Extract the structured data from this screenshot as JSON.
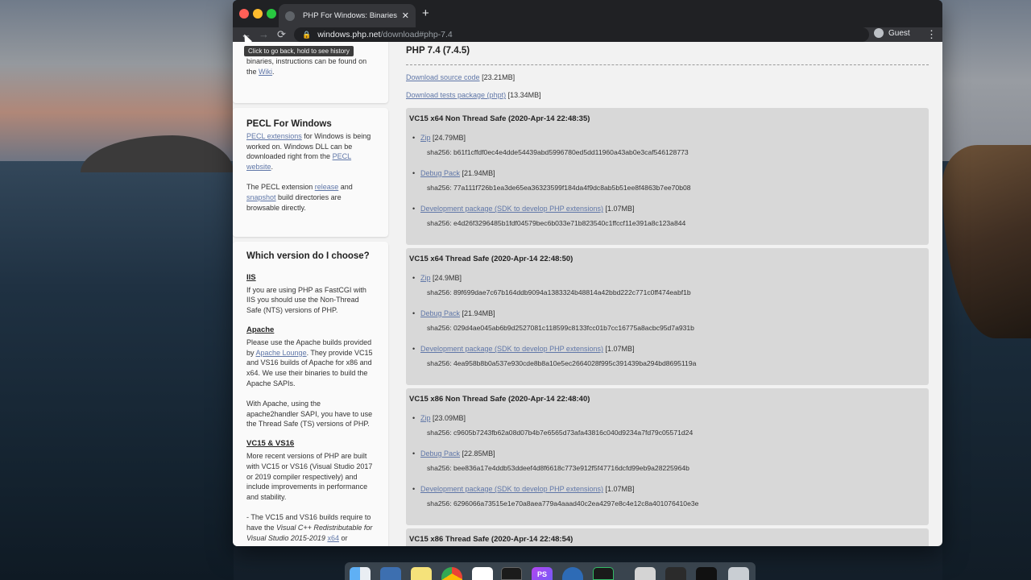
{
  "browser": {
    "tab_title": "PHP For Windows: Binaries and",
    "tab_close": "✕",
    "new_tab": "+",
    "back": "←",
    "forward": "→",
    "reload": "⟳",
    "lock": "🔒",
    "url_host": "windows.php.net",
    "url_path": "/download#php-7.4",
    "profile": "Guest",
    "menu": "⋮",
    "tooltip": "Click to go back, hold to see history"
  },
  "sidebar": {
    "card1": {
      "text_a": "binaries, instructions can be found on the",
      "link": "Wiki",
      "text_b": "."
    },
    "pecl": {
      "title": "PECL For Windows",
      "link1": "PECL extensions",
      "text1": " for Windows is being worked on. Windows DLL can be downloaded right from the ",
      "link2": "PECL website",
      "text2": ".",
      "text3": "The PECL extension ",
      "link3": "release",
      "text4": " and ",
      "link4": "snapshot",
      "text5": " build directories are browsable directly."
    },
    "choose": {
      "title": "Which version do I choose?",
      "iis_h": "IIS",
      "iis_p": "If you are using PHP as FastCGI with IIS you should use the Non-Thread Safe (NTS) versions of PHP.",
      "apache_h": "Apache",
      "apache_p1": "Please use the Apache builds provided by ",
      "apache_link": "Apache Lounge",
      "apache_p2": ". They provide VC15 and VS16 builds of Apache for x86 and x64. We use their binaries to build the Apache SAPIs.",
      "apache_p3": "With Apache, using the apache2handler SAPI, you have to use the Thread Safe (TS) versions of PHP.",
      "vc_h": "VC15 & VS16",
      "vc_p": "More recent versions of PHP are built with VC15 or VS16 (Visual Studio 2017 or 2019 compiler respectively) and include improvements in performance and stability.",
      "vc_p2a": "- The VC15 and VS16 builds require to have the ",
      "vc_p2i": "Visual C++ Redistributable for Visual Studio 2015-2019",
      "vc_p2l": "x64",
      "vc_p2b": " or"
    }
  },
  "main": {
    "version_title": "PHP 7.4 (7.4.5)",
    "source_link": "Download source code",
    "source_size": "[23.21MB]",
    "tests_link": "Download tests package (phpt)",
    "tests_size": "[13.34MB]",
    "builds": [
      {
        "title": "VC15 x64 Non Thread Safe (2020-Apr-14 22:48:35)",
        "items": [
          {
            "label": "Zip",
            "size": "[24.79MB]",
            "sha": "sha256: b61f1cffdf0ec4e4dde54439abd5996780ed5dd11960a43ab0e3caf546128773"
          },
          {
            "label": "Debug Pack",
            "size": "[21.94MB]",
            "sha": "sha256: 77a111f726b1ea3de65ea36323599f184da4f9dc8ab5b51ee8f4863b7ee70b08"
          },
          {
            "label": "Development package (SDK to develop PHP extensions)",
            "size": "[1.07MB]",
            "sha": "sha256: e4d26f3296485b1fdf04579bec6b033e71b823540c1ffccf11e391a8c123a844"
          }
        ]
      },
      {
        "title": "VC15 x64 Thread Safe (2020-Apr-14 22:48:50)",
        "items": [
          {
            "label": "Zip",
            "size": "[24.9MB]",
            "sha": "sha256: 89f699dae7c67b164ddb9094a1383324b48814a42bbd222c771c0ff474eabf1b"
          },
          {
            "label": "Debug Pack",
            "size": "[21.94MB]",
            "sha": "sha256: 029d4ae045ab6b9d2527081c118599c8133fcc01b7cc16775a8acbc95d7a931b"
          },
          {
            "label": "Development package (SDK to develop PHP extensions)",
            "size": "[1.07MB]",
            "sha": "sha256: 4ea958b8b0a537e930cde8b8a10e5ec2664028f995c391439ba294bd8695119a"
          }
        ]
      },
      {
        "title": "VC15 x86 Non Thread Safe (2020-Apr-14 22:48:40)",
        "items": [
          {
            "label": "Zip",
            "size": "[23.09MB]",
            "sha": "sha256: c9605b7243fb62a08d07b4b7e6565d73afa43816c040d9234a7fd79c05571d24"
          },
          {
            "label": "Debug Pack",
            "size": "[22.85MB]",
            "sha": "sha256: bee836a17e4ddb53ddeef4d8f6618c773e912f5f47716dcfd99eb9a28225964b"
          },
          {
            "label": "Development package (SDK to develop PHP extensions)",
            "size": "[1.07MB]",
            "sha": "sha256: 6296066a73515e1e70a8aea779a4aaad40c2ea4297e8c4e12c8a401076410e3e"
          }
        ]
      },
      {
        "title": "VC15 x86 Thread Safe (2020-Apr-14 22:48:54)",
        "items": []
      }
    ]
  },
  "dock": {
    "items": [
      "finder-icon",
      "preview-icon",
      "notes-icon",
      "chrome-icon",
      "slack-icon",
      "terminal-icon",
      "phpstorm-icon",
      "network-icon",
      "activity-monitor-icon",
      "photos-icon",
      "app-icon",
      "app2-icon",
      "trash-icon"
    ],
    "ps_label": "PS"
  },
  "colors": {
    "link": "#6077a8",
    "build_bg": "#d8d8d8",
    "page_bg": "#f2f2f2"
  }
}
